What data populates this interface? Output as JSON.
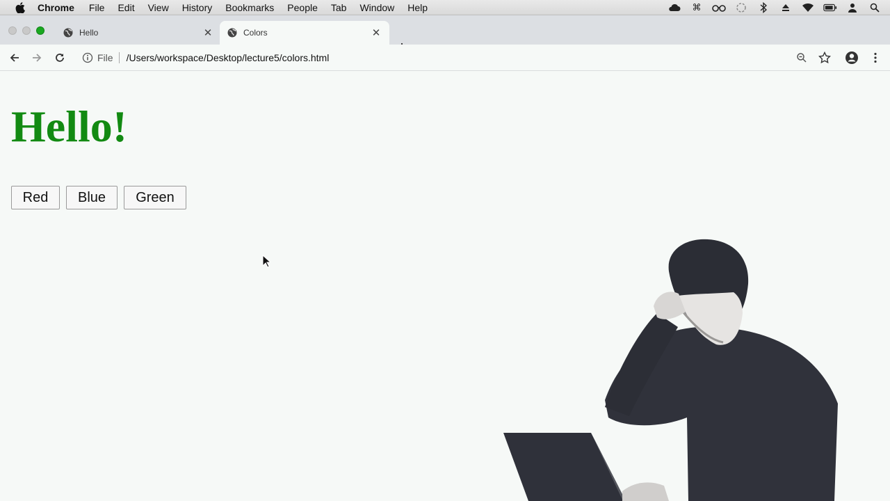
{
  "menubar": {
    "app_name": "Chrome",
    "items": [
      "File",
      "Edit",
      "View",
      "History",
      "Bookmarks",
      "People",
      "Tab",
      "Window",
      "Help"
    ],
    "status_icons": [
      "cloud-icon",
      "command-icon",
      "glasses-icon",
      "sync-icon",
      "bluetooth-icon",
      "eject-icon",
      "wifi-icon",
      "battery-icon",
      "user-icon",
      "spotlight-icon"
    ]
  },
  "tabs": [
    {
      "title": "Hello",
      "active": false
    },
    {
      "title": "Colors",
      "active": true
    }
  ],
  "toolbar": {
    "scheme_label": "File",
    "url": "/Users/workspace/Desktop/lecture5/colors.html"
  },
  "page": {
    "heading": "Hello!",
    "heading_color": "#128a12",
    "buttons": [
      "Red",
      "Blue",
      "Green"
    ]
  }
}
